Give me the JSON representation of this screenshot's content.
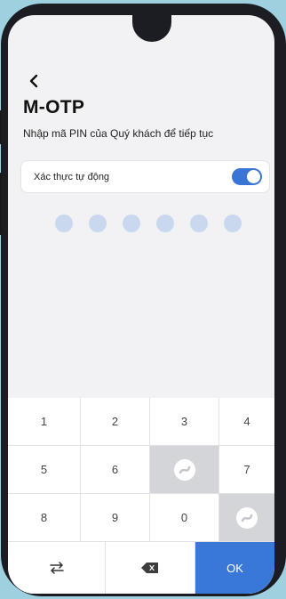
{
  "header": {
    "back_icon": "chevron-left-icon",
    "title": "M-OTP",
    "subtitle": "Nhập mã PIN của Quý khách để tiếp tục"
  },
  "auto_auth": {
    "label": "Xác thực tự động",
    "enabled": true,
    "accent_color": "#3a74d6"
  },
  "pin": {
    "length": 6,
    "filled": 0
  },
  "keypad": {
    "rows": [
      [
        "1",
        "2",
        "3",
        "4"
      ],
      [
        "5",
        "6",
        "logo",
        "7"
      ],
      [
        "8",
        "9",
        "0",
        "logo"
      ]
    ],
    "swap_icon": "swap-arrows-icon",
    "backspace_icon": "backspace-icon",
    "ok_label": "OK",
    "ok_color": "#3a78d8"
  }
}
